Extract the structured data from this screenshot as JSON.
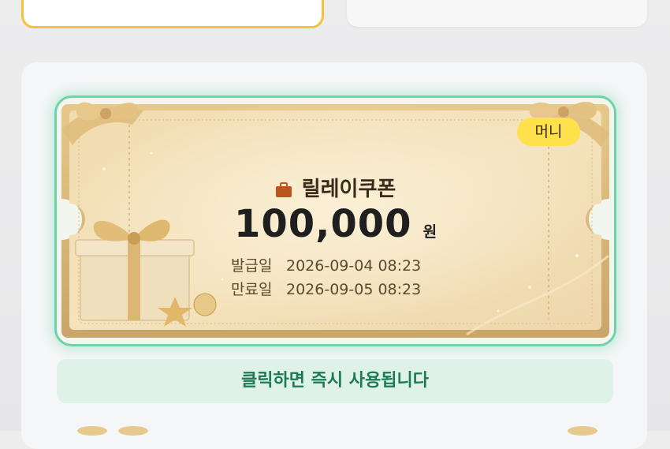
{
  "coupon": {
    "badge": "머니",
    "title": "릴레이쿠폰",
    "amount": "100,000",
    "unit": "원",
    "issued_label": "발급일",
    "issued_date": "2026-09-04 08:23",
    "expiry_label": "만료일",
    "expiry_date": "2026-09-05 08:23"
  },
  "use_button": {
    "label": "클릭하면 즉시 사용됩니다"
  },
  "colors": {
    "accent_border": "#6fd3a9",
    "badge_bg": "#ffe14b",
    "selected_card_border": "#f5c23a",
    "button_text": "#1d7a52"
  },
  "icons": {
    "title_icon": "briefcase-icon"
  }
}
